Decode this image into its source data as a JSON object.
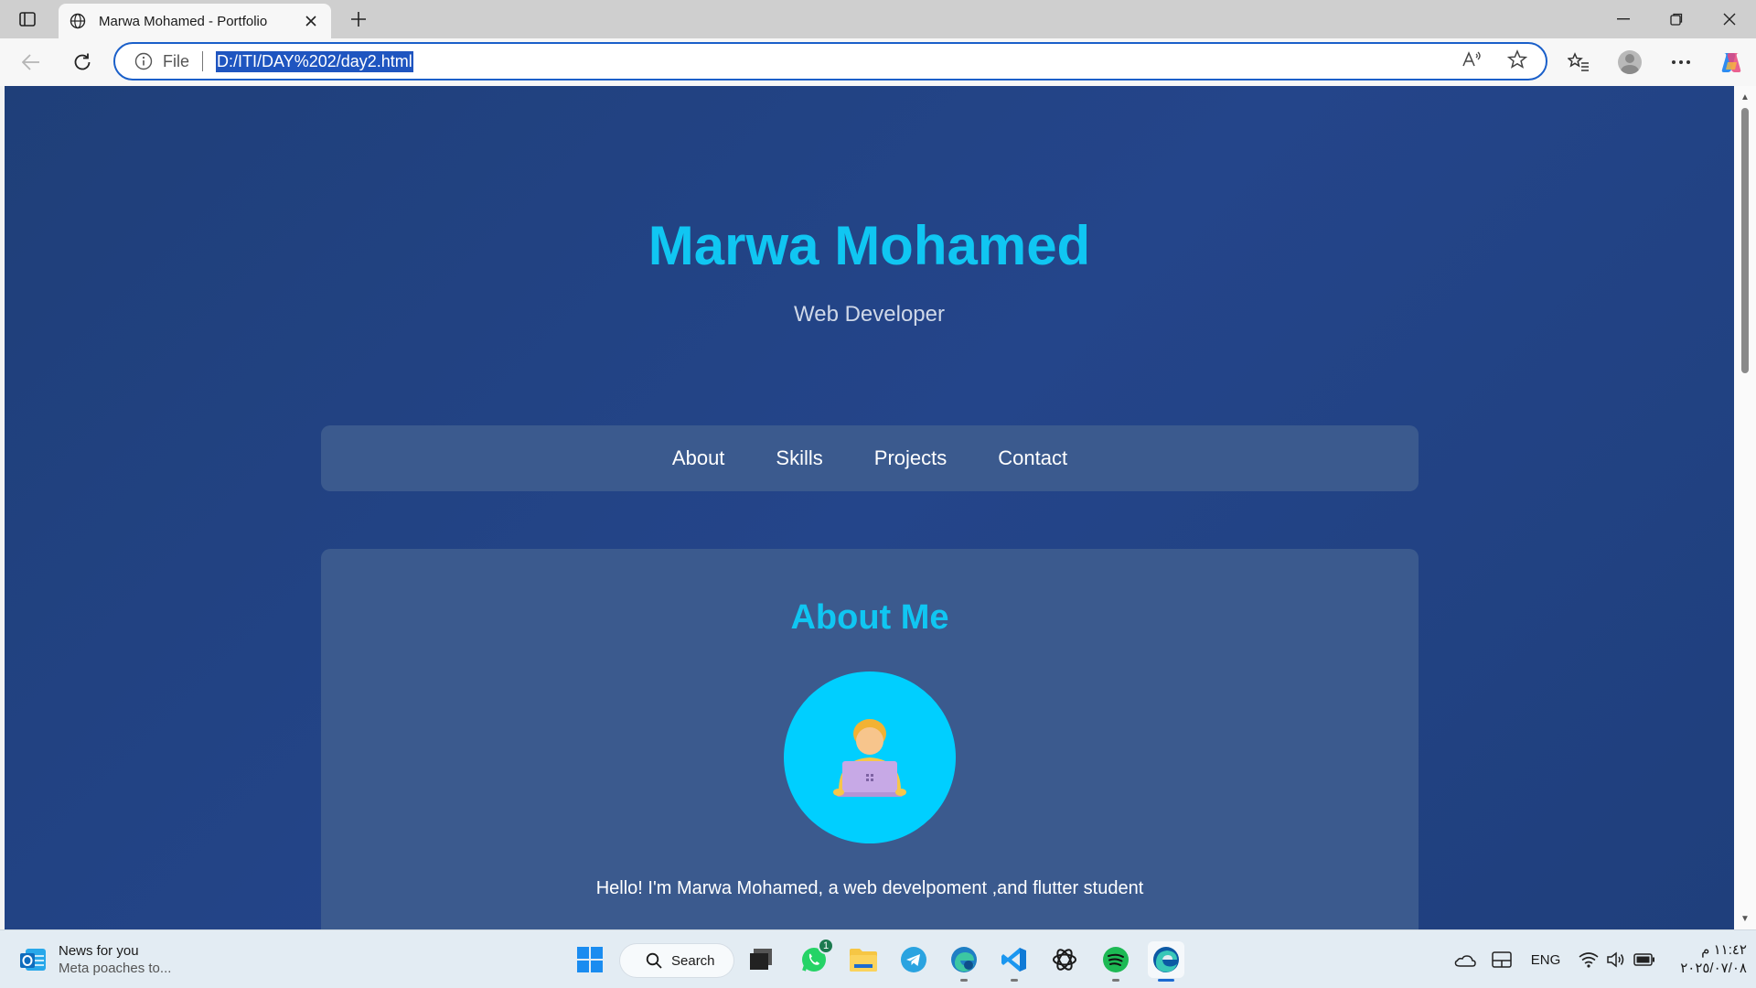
{
  "browser": {
    "tab_title": "Marwa Mohamed - Portfolio",
    "address": {
      "scheme_label": "File",
      "url": "D:/ITI/DAY%202/day2.html"
    }
  },
  "page": {
    "hero": {
      "name": "Marwa Mohamed",
      "subtitle": "Web Developer"
    },
    "nav": {
      "items": [
        "About",
        "Skills",
        "Projects",
        "Contact"
      ]
    },
    "about": {
      "title": "About Me",
      "avatar_icon": "technologist-emoji",
      "text": "Hello! I'm Marwa Mohamed, a web develpoment ,and flutter student"
    },
    "colors": {
      "accent": "#10c6f2",
      "background": "#23438a",
      "card": "#3b5a8e"
    }
  },
  "taskbar": {
    "news": {
      "title": "News for you",
      "subtitle": "Meta poaches to..."
    },
    "search_label": "Search",
    "whatsapp_badge": "1",
    "tray": {
      "language": "ENG",
      "time": "١١:٤٢ م",
      "date": "٢٠٢٥/٠٧/٠٨"
    }
  }
}
